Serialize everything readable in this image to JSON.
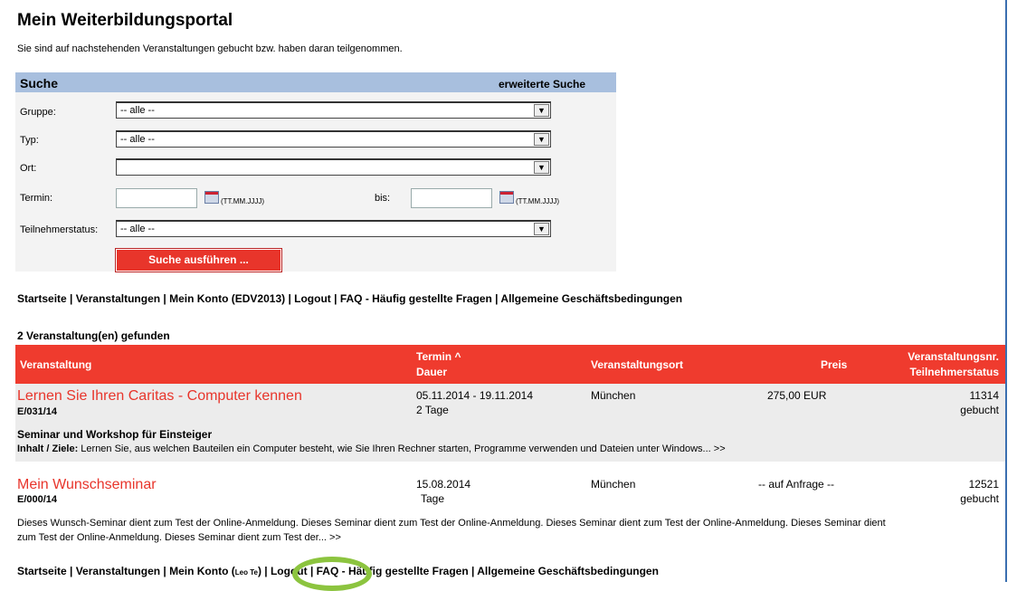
{
  "page": {
    "title": "Mein Weiterbildungsportal",
    "intro": "Sie sind auf nachstehenden Veranstaltungen gebucht bzw. haben daran teilgenommen."
  },
  "search": {
    "title": "Suche",
    "advanced": "erweiterte Suche",
    "group_label": "Gruppe:",
    "group_value": "-- alle --",
    "type_label": "Typ:",
    "type_value": "-- alle --",
    "place_label": "Ort:",
    "place_value": "",
    "date_label": "Termin:",
    "date_hint": "(TT.MM.JJJJ)",
    "to_label": "bis:",
    "status_label": "Teilnehmerstatus:",
    "status_value": "-- alle --",
    "button": "Suche ausführen ..."
  },
  "nav_top": "Startseite | Veranstaltungen | Mein Konto (EDV2013) | Logout | FAQ - Häufig gestellte Fragen | Allgemeine Geschäftsbedingungen",
  "nav_bottom": {
    "part1": "Startseite | Veranstaltungen | Mein Konto (",
    "user": "Leo Te",
    "part2": ") | Logout | FA",
    "part3": "Q - Häufig gestellte Fragen | Allgemeine Geschäftsbedingungen"
  },
  "results": {
    "count": "2 Veranstaltung(en) gefunden",
    "headers": {
      "event": "Veranstaltung",
      "date": "Termin",
      "date_arrow": "^",
      "duration": "Dauer",
      "place": "Veranstaltungsort",
      "price": "Preis",
      "number": "Veranstaltungsnr.",
      "status": "Teilnehmerstatus"
    },
    "rows": [
      {
        "title": "Lernen Sie Ihren Caritas - Computer kennen",
        "code": "E/031/14",
        "date": "05.11.2014  - 19.11.2014",
        "duration": "2 Tage",
        "place": "München",
        "price": "275,00 EUR",
        "number": "11314",
        "status": "gebucht",
        "subtitle": "Seminar und Workshop für Einsteiger",
        "goal_label": "Inhalt / Ziele:",
        "desc": " Lernen Sie, aus welchen Bauteilen ein Computer besteht, wie Sie Ihren Rechner starten, Programme verwenden und Dateien unter Windows...  >>"
      },
      {
        "title": "Mein Wunschseminar",
        "code": "E/000/14",
        "date": "15.08.2014",
        "duration": "Tage",
        "place": "München",
        "price": "-- auf Anfrage --",
        "number": "12521",
        "status": "gebucht",
        "desc1": "Dieses Wunsch-Seminar dient zum Test der Online-Anmeldung. Dieses Seminar dient zum Test der Online-Anmeldung. Dieses Seminar dient zum Test der Online-Anmeldung. Dieses Seminar dient",
        "desc2": "zum Test der Online-Anmeldung. Dieses Seminar dient zum Test der...  >>"
      }
    ]
  },
  "colors": {
    "accent": "#e8352b",
    "search_header": "#a8bfde",
    "highlight": "#8cc43f"
  }
}
